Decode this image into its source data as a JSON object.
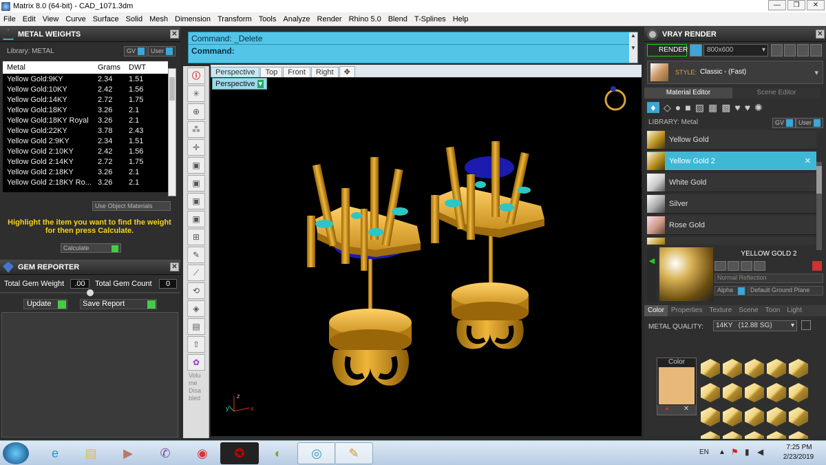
{
  "window": {
    "title": "Matrix 8.0 (64-bit) - CAD_1071.3dm",
    "controls": [
      "—",
      "❐",
      "✕"
    ]
  },
  "menu": [
    "File",
    "Edit",
    "View",
    "Curve",
    "Surface",
    "Solid",
    "Mesh",
    "Dimension",
    "Transform",
    "Tools",
    "Analyze",
    "Render",
    "Rhino 5.0",
    "Blend",
    "T-Splines",
    "Help"
  ],
  "metal_weights": {
    "title": "METAL WEIGHTS",
    "library_label": "Library: METAL",
    "gv": "GV",
    "user": "User",
    "columns": [
      "Metal",
      "Grams",
      "DWT"
    ],
    "rows": [
      [
        "Yellow Gold:9KY",
        "2.34",
        "1.51"
      ],
      [
        "Yellow Gold:10KY",
        "2.42",
        "1.56"
      ],
      [
        "Yellow Gold:14KY",
        "2.72",
        "1.75"
      ],
      [
        "Yellow Gold:18KY",
        "3.26",
        "2.1"
      ],
      [
        "Yellow Gold:18KY Royal",
        "3.26",
        "2.1"
      ],
      [
        "Yellow Gold:22KY",
        "3.78",
        "2.43"
      ],
      [
        "Yellow Gold 2:9KY",
        "2.34",
        "1.51"
      ],
      [
        "Yellow Gold 2:10KY",
        "2.42",
        "1.56"
      ],
      [
        "Yellow Gold 2:14KY",
        "2.72",
        "1.75"
      ],
      [
        "Yellow Gold 2:18KY",
        "3.26",
        "2.1"
      ],
      [
        "Yellow Gold 2:18KY Ro...",
        "3.26",
        "2.1"
      ]
    ],
    "use_object_materials": "Use Object Materials",
    "hint": "Highlight the item you want to find the weight for then press Calculate.",
    "calculate": "Calculate"
  },
  "gem_reporter": {
    "title": "GEM REPORTER",
    "total_weight_label": "Total Gem Weight",
    "total_weight": ".00",
    "total_count_label": "Total Gem Count",
    "total_count": "0",
    "update": "Update",
    "save_report": "Save Report"
  },
  "command": {
    "line1": "Command: _Delete",
    "line2": "Command:"
  },
  "view_tabs": [
    "Perspective",
    "Top",
    "Front",
    "Right",
    "✥"
  ],
  "viewport_label": "Perspective",
  "tool_volume_label": "Volume Disabled",
  "axes": {
    "z": "z",
    "x": "x",
    "y": "y"
  },
  "vray": {
    "title": "VRAY RENDER",
    "render": "RENDER",
    "resolution": "800x600",
    "style_label": "STYLE:",
    "style_value": "Classic - (Fast)",
    "tabs": [
      "Material Editor",
      "Scene Editor"
    ],
    "library_label": "LIBRARY: Metal",
    "gv": "GV",
    "user": "User",
    "materials": [
      "Yellow Gold",
      "Yellow Gold 2",
      "White Gold",
      "Silver",
      "Rose Gold"
    ],
    "selected_index": 1,
    "preview_name": "YELLOW GOLD 2",
    "reflection": "Normal Reflection",
    "alpha": "Alpha",
    "ground": "Default Ground Plane",
    "subtabs": [
      "Color",
      "Properties",
      "Texture",
      "Scene",
      "Toon",
      "Light"
    ],
    "metal_quality_label": "METAL QUALITY:",
    "metal_quality": "14KY",
    "metal_sg": "(12.88 SG)",
    "color_label": "Color",
    "swatch_color": "#e7b87a"
  },
  "taskbar": {
    "lang": "EN",
    "time": "7:25 PM",
    "date": "2/23/2019"
  }
}
